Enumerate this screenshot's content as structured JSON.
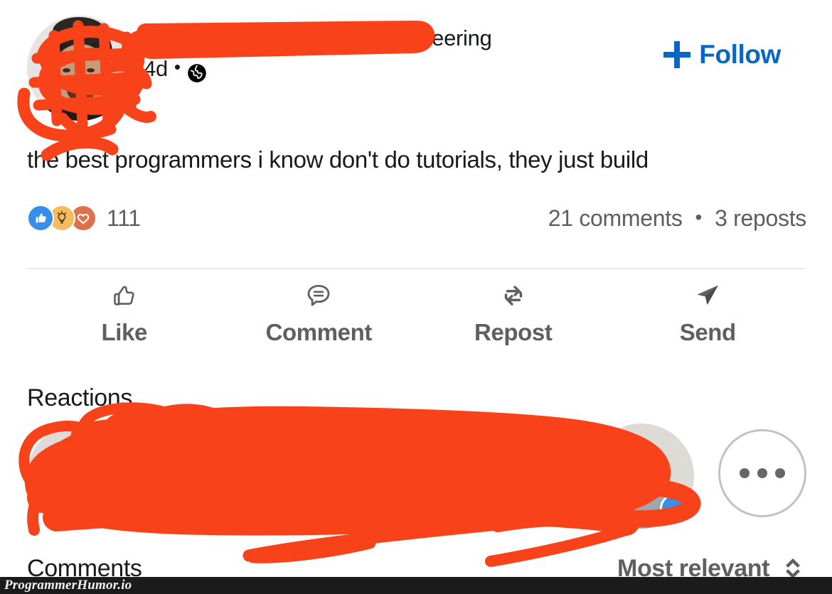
{
  "platform": "linkedin-post",
  "colors": {
    "brand_blue": "#0a66c2",
    "scribble_orange": "#f8431a",
    "text_primary": "#191919",
    "text_secondary": "#5e5e5e",
    "divider": "#e9e9e9",
    "watermark_bar": "#1b1b1b"
  },
  "post": {
    "author": {
      "name": "",
      "name_censored": true,
      "headline": "Obsessed with software engineering",
      "timestamp": "4d",
      "meta_separator": "•",
      "visibility_icon": "globe-icon",
      "avatar_censored": true
    },
    "follow": {
      "label": "Follow",
      "icon": "plus-icon"
    },
    "body_text": "the best programmers i know don't do tutorials, they just build",
    "social": {
      "reaction_icons": [
        "like-thumb-icon",
        "insightful-bulb-icon",
        "love-heart-icon"
      ],
      "reaction_count": "111",
      "comments": "21 comments",
      "separator": "•",
      "reposts": "3 reposts"
    },
    "actions": [
      {
        "label": "Like",
        "icon": "thumbs-up-icon"
      },
      {
        "label": "Comment",
        "icon": "speech-bubble-icon"
      },
      {
        "label": "Repost",
        "icon": "repost-loop-icon"
      },
      {
        "label": "Send",
        "icon": "paper-plane-icon"
      }
    ]
  },
  "reactions_section": {
    "title": "Reactions",
    "censored": true,
    "more_button_icon": "ellipsis-icon"
  },
  "comments_section": {
    "title": "Comments",
    "sort": {
      "label": "Most relevant",
      "icon": "chevron-up-down-icon"
    }
  },
  "watermark": {
    "text": "ProgrammerHumor.io"
  }
}
